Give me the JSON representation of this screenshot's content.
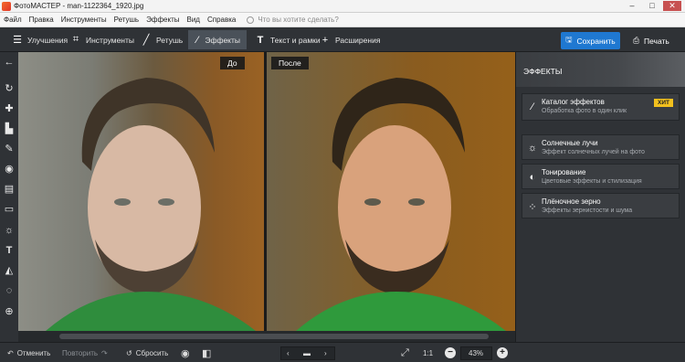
{
  "window": {
    "title": "ФотоМАСТЕР - man-1122364_1920.jpg"
  },
  "menu": {
    "items": [
      "Файл",
      "Правка",
      "Инструменты",
      "Ретушь",
      "Эффекты",
      "Вид",
      "Справка"
    ],
    "search_placeholder": "Что вы хотите сделать?"
  },
  "toolbar": {
    "tabs": [
      {
        "label": "Улучшения",
        "icon": "sliders-icon"
      },
      {
        "label": "Инструменты",
        "icon": "crop-icon"
      },
      {
        "label": "Ретушь",
        "icon": "brush-icon"
      },
      {
        "label": "Эффекты",
        "icon": "magic-wand-icon",
        "active": true
      },
      {
        "label": "Текст и рамки",
        "icon": "text-icon"
      },
      {
        "label": "Расширения",
        "icon": "plus-icon"
      }
    ],
    "save_label": "Сохранить",
    "print_label": "Печать",
    "accent_color": "#1f78d1"
  },
  "left_tools": [
    "back-arrow-icon",
    "rotate-icon",
    "patch-icon",
    "stamp-icon",
    "brush-icon",
    "radial-filter-icon",
    "gradient-filter-icon",
    "vignette-icon",
    "sun-icon",
    "text-icon",
    "fill-icon",
    "lasso-icon",
    "target-icon"
  ],
  "compare": {
    "before_label": "До",
    "after_label": "После"
  },
  "effects_panel": {
    "title": "ЭФФЕКТЫ",
    "items": [
      {
        "name": "Каталог эффектов",
        "desc": "Обработка фото в один клик",
        "badge": "ХИТ",
        "icon": "magic-wand-icon"
      },
      {
        "name": "Солнечные лучи",
        "desc": "Эффект солнечных лучей на фото",
        "icon": "sun-icon"
      },
      {
        "name": "Тонирование",
        "desc": "Цветовые эффекты и стилизация",
        "icon": "half-circle-icon"
      },
      {
        "name": "Плёночное зерно",
        "desc": "Эффекты зернистости и шума",
        "icon": "grain-icon"
      }
    ],
    "badge_color": "#f2c01e"
  },
  "bottom": {
    "undo_label": "Отменить",
    "redo_label": "Повторить",
    "reset_label": "Сбросить",
    "ratio_label": "1:1",
    "zoom_value": "43%"
  }
}
